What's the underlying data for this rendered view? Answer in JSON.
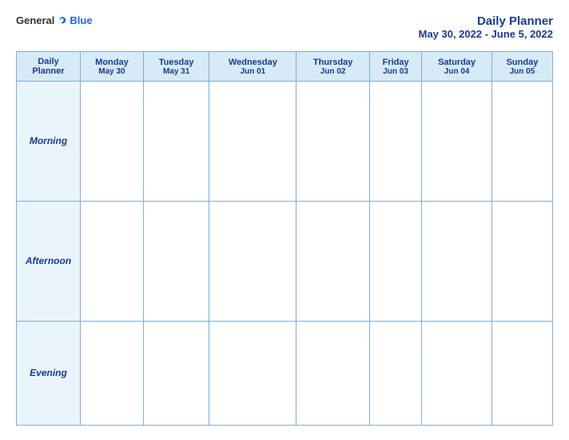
{
  "logo": {
    "general": "General",
    "blue": "Blue"
  },
  "title": {
    "main": "Daily Planner",
    "date_range": "May 30, 2022 - June 5, 2022"
  },
  "columns": [
    {
      "id": "label",
      "name": "Daily",
      "name2": "Planner",
      "date": ""
    },
    {
      "id": "mon",
      "name": "Monday",
      "date": "May 30"
    },
    {
      "id": "tue",
      "name": "Tuesday",
      "date": "May 31"
    },
    {
      "id": "wed",
      "name": "Wednesday",
      "date": "Jun 01"
    },
    {
      "id": "thu",
      "name": "Thursday",
      "date": "Jun 02"
    },
    {
      "id": "fri",
      "name": "Friday",
      "date": "Jun 03"
    },
    {
      "id": "sat",
      "name": "Saturday",
      "date": "Jun 04"
    },
    {
      "id": "sun",
      "name": "Sunday",
      "date": "Jun 05"
    }
  ],
  "rows": [
    {
      "id": "morning",
      "label": "Morning"
    },
    {
      "id": "afternoon",
      "label": "Afternoon"
    },
    {
      "id": "evening",
      "label": "Evening"
    }
  ]
}
